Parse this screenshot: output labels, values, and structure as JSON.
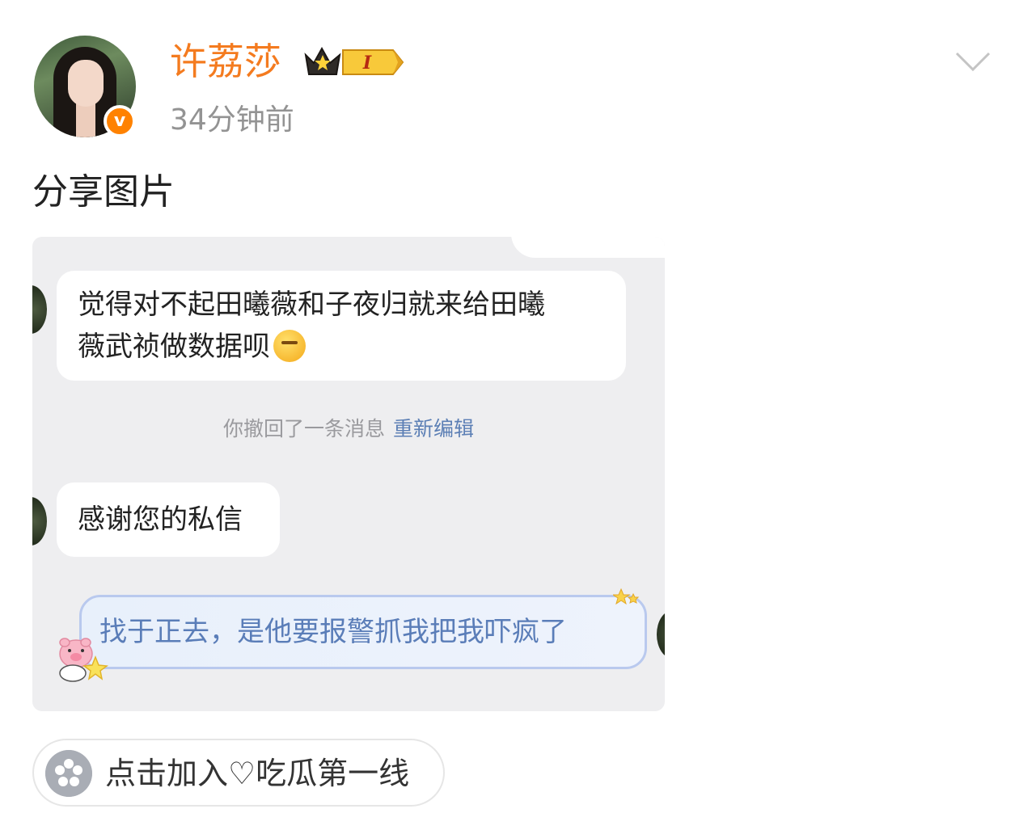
{
  "post": {
    "username": "许荔莎",
    "time": "34分钟前",
    "text": "分享图片",
    "member_level": "I",
    "verified_mark": "v"
  },
  "screenshot": {
    "message_1_line_1": "觉得对不起田曦薇和子夜归就来给田曦",
    "message_1_line_2": "薇武祯做数据呗",
    "system_notice": "你撤回了一条消息",
    "system_action": "重新编辑",
    "message_2": "感谢您的私信",
    "message_3": "找于正去，是他要报警抓我把我吓疯了"
  },
  "topic": {
    "label": "点击加入♡吃瓜第一线"
  },
  "icons": {
    "verified": "verified-v-icon",
    "member": "crown-member-badge-icon",
    "more": "chevron-down-icon",
    "topic": "group-flower-icon",
    "emoji": "thinking-face-emoji-icon"
  },
  "colors": {
    "username": "#f47b1f",
    "verified": "#ff8200",
    "time": "#939393",
    "bubble_blue_text": "#5a7db8",
    "re_edit_link": "#5c7fb5"
  }
}
